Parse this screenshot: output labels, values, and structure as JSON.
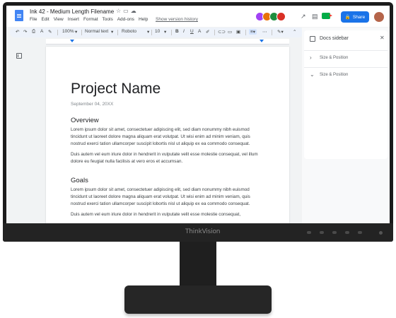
{
  "monitor": {
    "brand": "ThinkVision"
  },
  "titlebar": {
    "doc_title": "Ink 42 - Medium Length Filename",
    "title_icons": [
      "star-icon",
      "move-folder-icon",
      "cloud-status-icon"
    ],
    "menu": [
      "File",
      "Edit",
      "View",
      "Insert",
      "Format",
      "Tools",
      "Add-ons",
      "Help"
    ],
    "version_link": "Show version history",
    "share_label": "Share",
    "collaborator_colors": [
      "#a142f4",
      "#e8710a",
      "#1e8e3e",
      "#d93025"
    ]
  },
  "toolbar": {
    "zoom": "100%",
    "style": "Normal text",
    "font": "Roboto",
    "font_size": "10"
  },
  "document": {
    "title": "Project Name",
    "date": "September 04, 20XX",
    "sections": [
      {
        "heading": "Overview",
        "paragraphs": [
          "Lorem ipsum dolor sit amet, consectetuer adipiscing elit, sed diam nonummy nibh euismod tincidunt ut laoreet dolore magna aliquam erat volutpat. Ut wisi enim ad minim veniam, quis nostrud exerci tation ullamcorper suscipit lobortis nisl ut aliquip ex ea commodo consequat.",
          "Duis autem vel eum iriure dolor in hendrerit in vulputate velit esse molestie consequat, vel illum dolore eu feugiat nulla facilisis at vero eros et accumsan."
        ]
      },
      {
        "heading": "Goals",
        "paragraphs": [
          "Lorem ipsum dolor sit amet, consectetuer adipiscing elit, sed diam nonummy nibh euismod tincidunt ut laoreet dolore magna aliquam erat volutpat. Ut wisi enim ad minim veniam, quis nostrud exerci tation ullamcorper suscipit lobortis nisl ut aliquip ex ea commodo consequat.",
          "Duis autem vel eum iriure dolor in hendrerit in vulputate velit esse molestie consequat,"
        ]
      }
    ]
  },
  "sidebar": {
    "title": "Docs sidebar",
    "items": [
      {
        "label": "Size & Position",
        "state": "collapsed"
      },
      {
        "label": "Size & Position",
        "state": "expanded"
      }
    ]
  }
}
